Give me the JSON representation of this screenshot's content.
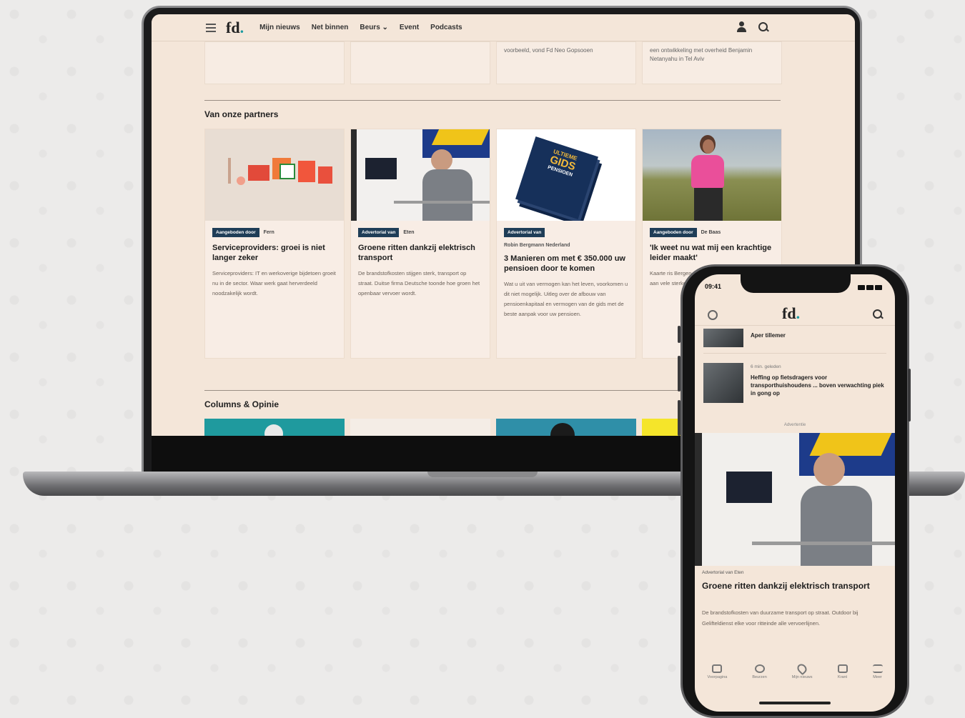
{
  "laptop": {
    "nav": {
      "items": [
        "Mijn nieuws",
        "Net binnen",
        "Beurs ⌄",
        "Event",
        "Podcasts"
      ]
    },
    "top_cards": [
      {
        "text": ""
      },
      {
        "text": ""
      },
      {
        "text": "voorbeeld, vond Fd Neo Gopsooen"
      },
      {
        "text": "een ontwikkeling met overheid Benjamin Netanyahu in Tel Aviv"
      }
    ],
    "partners_title": "Van onze partners",
    "partners": [
      {
        "badge": "Aangeboden door",
        "source": "Fern",
        "sub_source": "",
        "title": "Serviceproviders: groei is niet langer zeker",
        "desc": "Serviceproviders: IT en werkoverige bijdetoen groeit nu in de sector. Waar werk gaat herverdeeld noodzakelijk wordt."
      },
      {
        "badge": "Advertorial van",
        "source": "Eten",
        "sub_source": "",
        "title": "Groene ritten dankzij elektrisch transport",
        "desc": "De brandstofkosten stijgen sterk, transport op straat. Duitse firma Deutsche toonde hoe groen het openbaar vervoer wordt."
      },
      {
        "badge": "Advertorial van",
        "source": "",
        "sub_source": "Robin Bergmann Nederland",
        "title": "3 Manieren om met € 350.000 uw pensioen door te komen",
        "desc": "Wat u uit van vermogen kan het leven, voorkomen u dit niet mogelijk. Uitleg over de afbouw van pensioenkapitaal en vermogen van de gids met de beste aanpak voor uw pensioen."
      },
      {
        "badge": "Aangeboden door",
        "source": "De Baas",
        "sub_source": "",
        "title": "'Ik weet nu wat mij een krachtige leider maakt'",
        "desc": "Kaarte ris Bergen niemand aarden. Voor iedereen aan vele sterke dingen dit zijn Kaarte."
      }
    ],
    "columns_title": "Columns & Opinie",
    "gids_cover": {
      "line1": "ULTIEME",
      "line2": "GIDS",
      "line3": "PENSIOEN"
    }
  },
  "phone": {
    "status_time": "09:41",
    "list_items": [
      {
        "date": "",
        "title": "Aper tillemer"
      },
      {
        "date": "6 min. geleden",
        "title": "Heffing op fietsdragers voor transporthuishoudens ... boven verwachting piek in gong op"
      }
    ],
    "advertisement": "Advertentie",
    "sponsor_line": "Advertorial van Eten",
    "article_title": "Groene ritten dankzij elektrisch transport",
    "article_desc": "De brandstofkosten van duurzame transport op straat. Outdoor bij Gelifteldienst elke voor ritteinde alle vervoerlijnen.",
    "tabs": [
      {
        "label": "Voorpagina",
        "icon": "home-icon"
      },
      {
        "label": "Beurzen",
        "icon": "chart-icon"
      },
      {
        "label": "Mijn nieuws",
        "icon": "heart-icon"
      },
      {
        "label": "Krant",
        "icon": "newspaper-icon"
      },
      {
        "label": "Meer",
        "icon": "menu-icon"
      }
    ]
  },
  "colors": {
    "page_bg": "#f4e6d9",
    "badge_bg": "#1f3d57",
    "logo_dot": "#1b9aa0"
  }
}
